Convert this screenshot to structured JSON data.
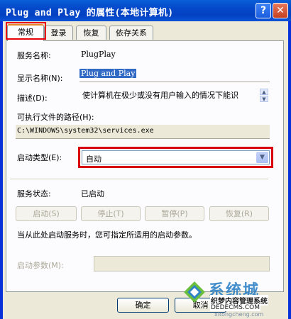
{
  "window": {
    "title": "Plug and Play 的属性(本地计算机)",
    "help_glyph": "?",
    "close_glyph": "✕"
  },
  "tabs": [
    {
      "label": "常规"
    },
    {
      "label": "登录"
    },
    {
      "label": "恢复"
    },
    {
      "label": "依存关系"
    }
  ],
  "general": {
    "service_name_label": "服务名称:",
    "service_name_value": "PlugPlay",
    "display_name_label": "显示名称(N):",
    "display_name_value": "Plug and Play",
    "description_label": "描述(D):",
    "description_value": "使计算机在极少或没有用户输入的情况下能识",
    "exec_path_label": "可执行文件的路径(H):",
    "exec_path_value": "C:\\WINDOWS\\system32\\services.exe",
    "startup_type_label": "启动类型(E):",
    "startup_type_value": "自动",
    "status_label": "服务状态:",
    "status_value": "已启动",
    "buttons": {
      "start": "启动(S)",
      "stop": "停止(T)",
      "pause": "暂停(P)",
      "resume": "恢复(R)"
    },
    "hint_text": "当从此处启动服务时，您可指定所适用的启动参数。",
    "params_label": "启动参数(M):",
    "params_value": ""
  },
  "footer": {
    "ok": "确定",
    "cancel": "取消"
  },
  "watermark": {
    "big": "系统城",
    "cn": "织梦内容管理系统",
    "url": "DEDECMS.COM",
    "small": "xitongcheng.com"
  },
  "colors": {
    "title_bar": "#0a52d8",
    "highlight_border": "#e8000b",
    "selection": "#316ac5"
  }
}
